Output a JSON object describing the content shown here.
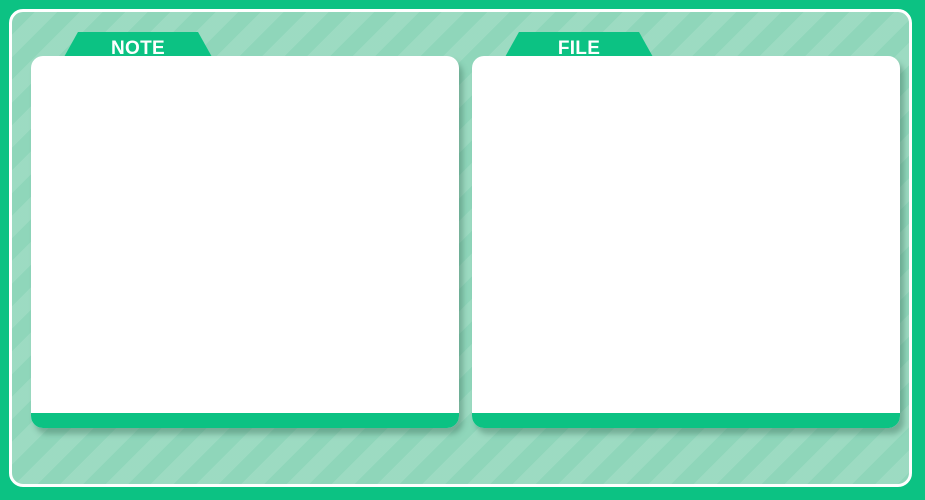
{
  "panels": {
    "note": {
      "tab_label": "NOTE"
    },
    "file": {
      "tab_label": "FILE"
    }
  },
  "colors": {
    "accent": "#0cc283",
    "background": "#8fd6ba",
    "card": "#ffffff",
    "border": "#ffffff"
  }
}
